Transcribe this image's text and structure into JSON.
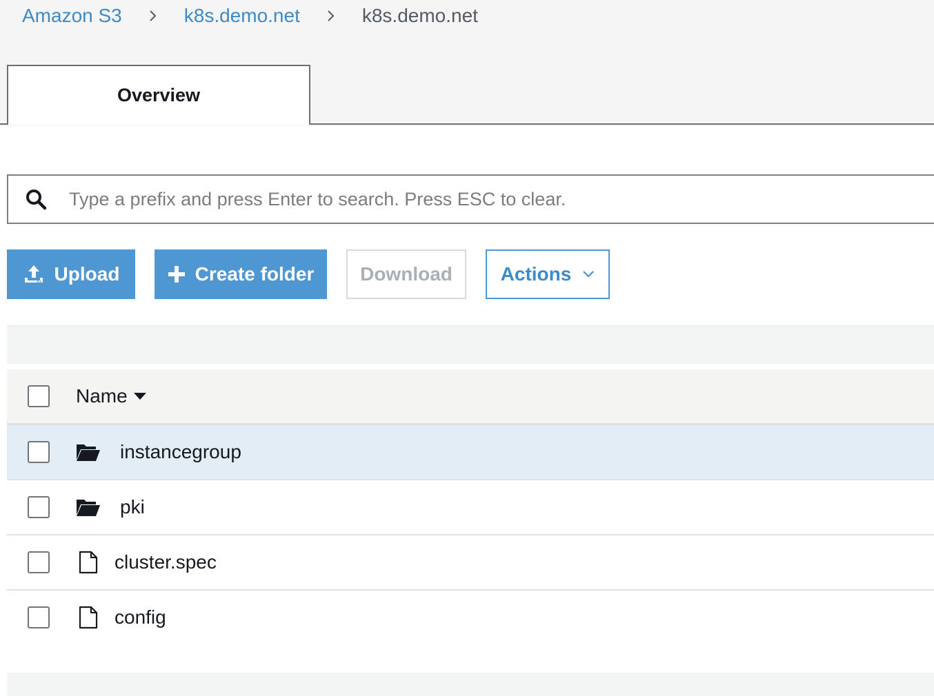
{
  "breadcrumb": {
    "items": [
      {
        "label": "Amazon S3"
      },
      {
        "label": "k8s.demo.net"
      },
      {
        "label": "k8s.demo.net"
      }
    ]
  },
  "tabs": [
    {
      "label": "Overview",
      "active": true
    }
  ],
  "search": {
    "placeholder": "Type a prefix and press Enter to search. Press ESC to clear.",
    "value": ""
  },
  "toolbar": {
    "upload_label": "Upload",
    "create_folder_label": "Create folder",
    "download_label": "Download",
    "actions_label": "Actions"
  },
  "table": {
    "columns": [
      {
        "label": "Name",
        "sort": "descending"
      }
    ],
    "rows": [
      {
        "name": "instancegroup",
        "type": "folder",
        "icon": "folder-open-icon",
        "selected": true
      },
      {
        "name": "pki",
        "type": "folder",
        "icon": "folder-open-icon",
        "selected": false
      },
      {
        "name": "cluster.spec",
        "type": "file",
        "icon": "file-icon",
        "selected": false
      },
      {
        "name": "config",
        "type": "file",
        "icon": "file-icon",
        "selected": false
      }
    ]
  },
  "colors": {
    "link": "#3c8bc8",
    "primary_button": "#4e97d3",
    "selected_row": "#e2edf6",
    "disabled_text": "#aab0b5"
  }
}
